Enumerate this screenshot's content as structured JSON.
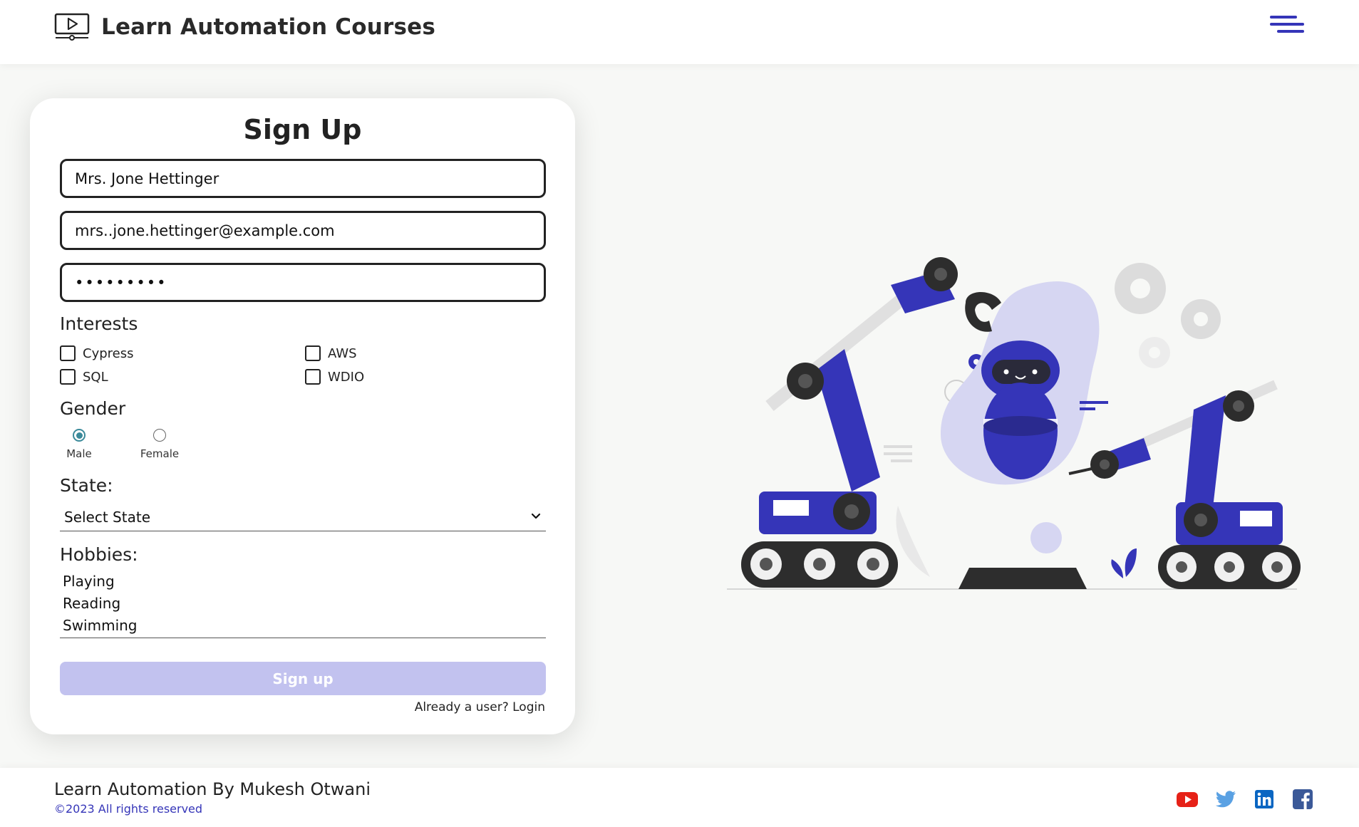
{
  "header": {
    "title": "Learn Automation Courses",
    "brand_icon": "video-play-monitor-icon",
    "menu_icon": "hamburger-menu-icon",
    "accent_color": "#3535b8"
  },
  "form": {
    "title": "Sign Up",
    "name_value": "Mrs. Jone Hettinger",
    "email_value": "mrs..jone.hettinger@example.com",
    "password_value": "passw0rd1",
    "interests_label": "Interests",
    "interests": [
      {
        "label": "Cypress",
        "checked": false
      },
      {
        "label": "AWS",
        "checked": false
      },
      {
        "label": "SQL",
        "checked": false
      },
      {
        "label": "WDIO",
        "checked": false
      }
    ],
    "gender_label": "Gender",
    "gender_options": [
      {
        "label": "Male",
        "selected": true
      },
      {
        "label": "Female",
        "selected": false
      }
    ],
    "state_label": "State:",
    "state_selected": "Select State",
    "hobbies_label": "Hobbies:",
    "hobbies_options": [
      "Playing",
      "Reading",
      "Swimming"
    ],
    "submit_label": "Sign up",
    "login_link": "Already a user? Login"
  },
  "illustration": {
    "icon": "robot-arms-illustration",
    "accent_color": "#3535b8"
  },
  "footer": {
    "title": "Learn Automation By Mukesh Otwani",
    "copyright": "©2023 All rights reserved",
    "social_icons": [
      "youtube-icon",
      "twitter-icon",
      "linkedin-icon",
      "facebook-icon"
    ]
  }
}
